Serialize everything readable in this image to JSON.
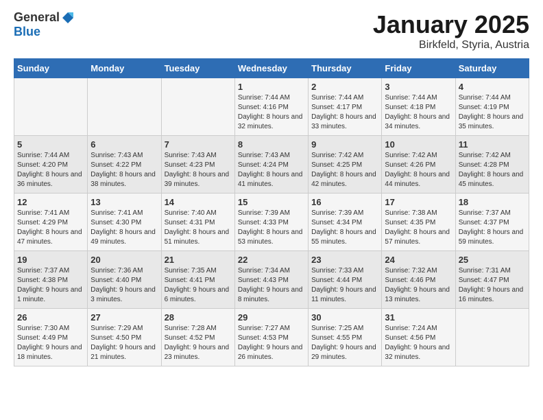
{
  "header": {
    "logo_general": "General",
    "logo_blue": "Blue",
    "month_title": "January 2025",
    "location": "Birkfeld, Styria, Austria"
  },
  "weekdays": [
    "Sunday",
    "Monday",
    "Tuesday",
    "Wednesday",
    "Thursday",
    "Friday",
    "Saturday"
  ],
  "weeks": [
    [
      {
        "day": "",
        "info": ""
      },
      {
        "day": "",
        "info": ""
      },
      {
        "day": "",
        "info": ""
      },
      {
        "day": "1",
        "info": "Sunrise: 7:44 AM\nSunset: 4:16 PM\nDaylight: 8 hours and 32 minutes."
      },
      {
        "day": "2",
        "info": "Sunrise: 7:44 AM\nSunset: 4:17 PM\nDaylight: 8 hours and 33 minutes."
      },
      {
        "day": "3",
        "info": "Sunrise: 7:44 AM\nSunset: 4:18 PM\nDaylight: 8 hours and 34 minutes."
      },
      {
        "day": "4",
        "info": "Sunrise: 7:44 AM\nSunset: 4:19 PM\nDaylight: 8 hours and 35 minutes."
      }
    ],
    [
      {
        "day": "5",
        "info": "Sunrise: 7:44 AM\nSunset: 4:20 PM\nDaylight: 8 hours and 36 minutes."
      },
      {
        "day": "6",
        "info": "Sunrise: 7:43 AM\nSunset: 4:22 PM\nDaylight: 8 hours and 38 minutes."
      },
      {
        "day": "7",
        "info": "Sunrise: 7:43 AM\nSunset: 4:23 PM\nDaylight: 8 hours and 39 minutes."
      },
      {
        "day": "8",
        "info": "Sunrise: 7:43 AM\nSunset: 4:24 PM\nDaylight: 8 hours and 41 minutes."
      },
      {
        "day": "9",
        "info": "Sunrise: 7:42 AM\nSunset: 4:25 PM\nDaylight: 8 hours and 42 minutes."
      },
      {
        "day": "10",
        "info": "Sunrise: 7:42 AM\nSunset: 4:26 PM\nDaylight: 8 hours and 44 minutes."
      },
      {
        "day": "11",
        "info": "Sunrise: 7:42 AM\nSunset: 4:28 PM\nDaylight: 8 hours and 45 minutes."
      }
    ],
    [
      {
        "day": "12",
        "info": "Sunrise: 7:41 AM\nSunset: 4:29 PM\nDaylight: 8 hours and 47 minutes."
      },
      {
        "day": "13",
        "info": "Sunrise: 7:41 AM\nSunset: 4:30 PM\nDaylight: 8 hours and 49 minutes."
      },
      {
        "day": "14",
        "info": "Sunrise: 7:40 AM\nSunset: 4:31 PM\nDaylight: 8 hours and 51 minutes."
      },
      {
        "day": "15",
        "info": "Sunrise: 7:39 AM\nSunset: 4:33 PM\nDaylight: 8 hours and 53 minutes."
      },
      {
        "day": "16",
        "info": "Sunrise: 7:39 AM\nSunset: 4:34 PM\nDaylight: 8 hours and 55 minutes."
      },
      {
        "day": "17",
        "info": "Sunrise: 7:38 AM\nSunset: 4:35 PM\nDaylight: 8 hours and 57 minutes."
      },
      {
        "day": "18",
        "info": "Sunrise: 7:37 AM\nSunset: 4:37 PM\nDaylight: 8 hours and 59 minutes."
      }
    ],
    [
      {
        "day": "19",
        "info": "Sunrise: 7:37 AM\nSunset: 4:38 PM\nDaylight: 9 hours and 1 minute."
      },
      {
        "day": "20",
        "info": "Sunrise: 7:36 AM\nSunset: 4:40 PM\nDaylight: 9 hours and 3 minutes."
      },
      {
        "day": "21",
        "info": "Sunrise: 7:35 AM\nSunset: 4:41 PM\nDaylight: 9 hours and 6 minutes."
      },
      {
        "day": "22",
        "info": "Sunrise: 7:34 AM\nSunset: 4:43 PM\nDaylight: 9 hours and 8 minutes."
      },
      {
        "day": "23",
        "info": "Sunrise: 7:33 AM\nSunset: 4:44 PM\nDaylight: 9 hours and 11 minutes."
      },
      {
        "day": "24",
        "info": "Sunrise: 7:32 AM\nSunset: 4:46 PM\nDaylight: 9 hours and 13 minutes."
      },
      {
        "day": "25",
        "info": "Sunrise: 7:31 AM\nSunset: 4:47 PM\nDaylight: 9 hours and 16 minutes."
      }
    ],
    [
      {
        "day": "26",
        "info": "Sunrise: 7:30 AM\nSunset: 4:49 PM\nDaylight: 9 hours and 18 minutes."
      },
      {
        "day": "27",
        "info": "Sunrise: 7:29 AM\nSunset: 4:50 PM\nDaylight: 9 hours and 21 minutes."
      },
      {
        "day": "28",
        "info": "Sunrise: 7:28 AM\nSunset: 4:52 PM\nDaylight: 9 hours and 23 minutes."
      },
      {
        "day": "29",
        "info": "Sunrise: 7:27 AM\nSunset: 4:53 PM\nDaylight: 9 hours and 26 minutes."
      },
      {
        "day": "30",
        "info": "Sunrise: 7:25 AM\nSunset: 4:55 PM\nDaylight: 9 hours and 29 minutes."
      },
      {
        "day": "31",
        "info": "Sunrise: 7:24 AM\nSunset: 4:56 PM\nDaylight: 9 hours and 32 minutes."
      },
      {
        "day": "",
        "info": ""
      }
    ]
  ]
}
